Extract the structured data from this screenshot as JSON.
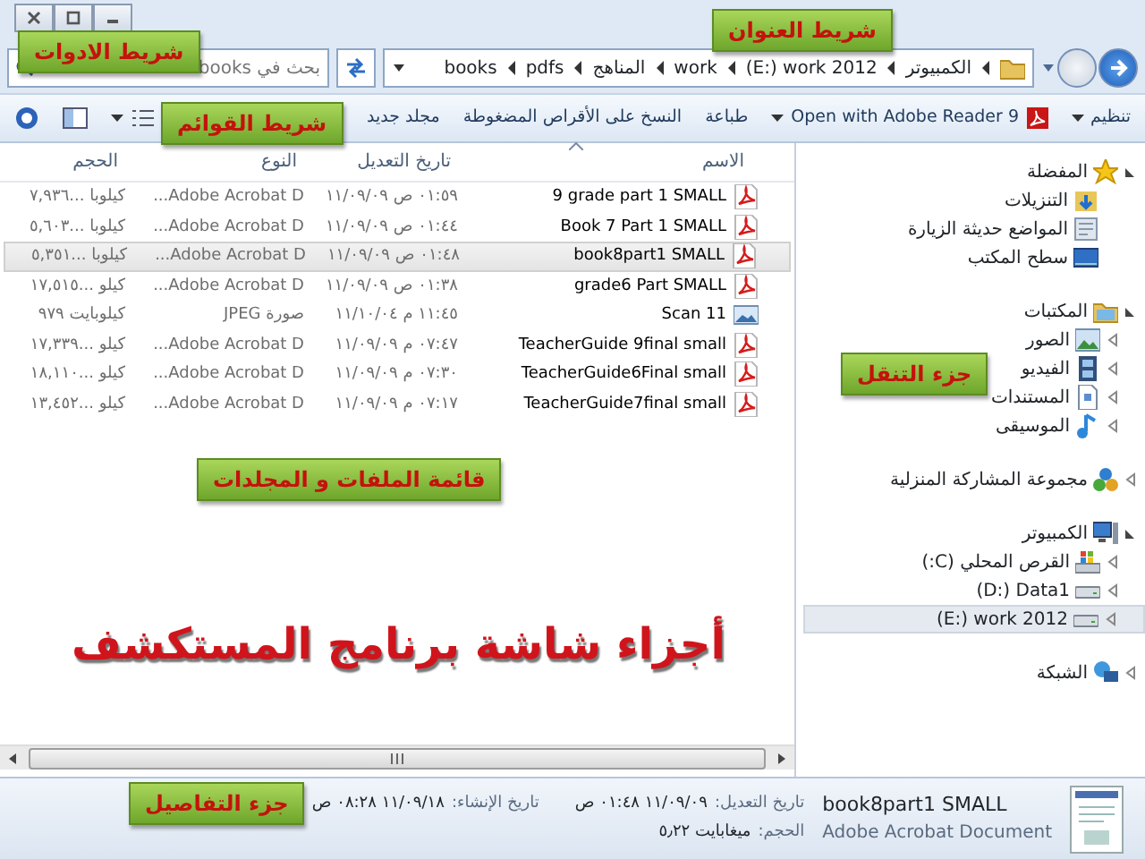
{
  "address_bar": {
    "crumbs": [
      "الكمبيوتر",
      "(E:) work 2012",
      "work",
      "المناهج",
      "pdfs",
      "books"
    ]
  },
  "search": {
    "placeholder": "بحث في books"
  },
  "toolbar": {
    "items": [
      {
        "label": "تنظيم",
        "kind": "menu"
      },
      {
        "label": "Open with Adobe Reader 9",
        "kind": "pdf-menu"
      },
      {
        "label": "طباعة",
        "kind": "plain"
      },
      {
        "label": "النسخ على الأقراص المضغوطة",
        "kind": "plain"
      },
      {
        "label": "مجلد جديد",
        "kind": "plain"
      }
    ]
  },
  "file_list": {
    "columns": [
      "الاسم",
      "تاريخ التعديل",
      "النوع",
      "الحجم"
    ],
    "rows": [
      {
        "name": "9 grade part 1 SMALL",
        "kind": "pdf",
        "date": "٠١:٥٩ ص ١١/٠٩/٠٩",
        "type": "Adobe Acrobat D...",
        "size": "كيلوبا ...٧,٩٣٦",
        "selected": false
      },
      {
        "name": "Book 7 Part 1 SMALL",
        "kind": "pdf",
        "date": "٠١:٤٤ ص ١١/٠٩/٠٩",
        "type": "Adobe Acrobat D...",
        "size": "كيلوبا ...٥,٦٠٣",
        "selected": false
      },
      {
        "name": "book8part1 SMALL",
        "kind": "pdf",
        "date": "٠١:٤٨ ص ١١/٠٩/٠٩",
        "type": "Adobe Acrobat D...",
        "size": "كيلوبا ...٥,٣٥١",
        "selected": true
      },
      {
        "name": "grade6 Part SMALL",
        "kind": "pdf",
        "date": "٠١:٣٨ ص ١١/٠٩/٠٩",
        "type": "Adobe Acrobat D...",
        "size": "كيلو ...١٧,٥١٥",
        "selected": false
      },
      {
        "name": "Scan 11",
        "kind": "image",
        "date": "١١:٤٥ م ١١/١٠/٠٤",
        "type": "صورة JPEG",
        "size": "كيلوبايت ٩٧٩",
        "selected": false
      },
      {
        "name": "TeacherGuide 9final small",
        "kind": "pdf",
        "date": "٠٧:٤٧ م ١١/٠٩/٠٩",
        "type": "Adobe Acrobat D...",
        "size": "كيلو ...١٧,٣٣٩",
        "selected": false
      },
      {
        "name": "TeacherGuide6Final small",
        "kind": "pdf",
        "date": "٠٧:٣٠ م ١١/٠٩/٠٩",
        "type": "Adobe Acrobat D...",
        "size": "كيلو ...١٨,١١٠",
        "selected": false
      },
      {
        "name": "TeacherGuide7final small",
        "kind": "pdf",
        "date": "٠٧:١٧ م ١١/٠٩/٠٩",
        "type": "Adobe Acrobat D...",
        "size": "كيلو ...١٣,٤٥٢",
        "selected": false
      }
    ]
  },
  "navigation_pane": {
    "groups": [
      {
        "label": "المفضلة",
        "kind": "favorites",
        "expanded": true,
        "children": [
          {
            "label": "التنزيلات",
            "kind": "downloads",
            "selected": false
          },
          {
            "label": "المواضع حديثة الزيارة",
            "kind": "recent",
            "selected": false
          },
          {
            "label": "سطح المكتب",
            "kind": "desktop",
            "selected": false
          }
        ]
      },
      {
        "label": "المكتبات",
        "kind": "libraries",
        "expanded": true,
        "children": [
          {
            "label": "الصور",
            "kind": "pictures",
            "expanded": false,
            "selected": false
          },
          {
            "label": "الفيديو",
            "kind": "videos",
            "expanded": false,
            "selected": false
          },
          {
            "label": "المستندات",
            "kind": "documents",
            "expanded": false,
            "selected": false
          },
          {
            "label": "الموسيقى",
            "kind": "music",
            "expanded": false,
            "selected": false
          }
        ]
      },
      {
        "label": "مجموعة المشاركة المنزلية",
        "kind": "homegroup",
        "expanded": false
      },
      {
        "label": "الكمبيوتر",
        "kind": "computer",
        "expanded": true,
        "children": [
          {
            "label": "القرص المحلي (C:)",
            "kind": "system-drive",
            "expanded": false,
            "selected": false
          },
          {
            "label": "(D:) Data1",
            "kind": "drive",
            "expanded": false,
            "selected": false
          },
          {
            "label": "(E:) work 2012",
            "kind": "drive",
            "expanded": false,
            "selected": true
          }
        ]
      },
      {
        "label": "الشبكة",
        "kind": "network",
        "expanded": false
      }
    ]
  },
  "details_pane": {
    "name": "book8part1 SMALL",
    "type": "Adobe Acrobat Document",
    "fields": [
      {
        "label": "تاريخ التعديل:",
        "value": "١١/٠٩/٠٩ ٠١:٤٨ ص"
      },
      {
        "label": "الحجم:",
        "value": "ميغابايت ٥٫٢٢"
      },
      {
        "label": "تاريخ الإنشاء:",
        "value": "١١/٠٩/١٨ ٠٨:٢٨ ص"
      }
    ]
  },
  "callouts": {
    "address_bar": "شريط العنوان",
    "toolbar": "شريط الادوات",
    "menu_bar": "شريط القوائم",
    "navigation_pane": "جزء التنقل",
    "file_list": "قائمة الملفات و المجلدات",
    "details_pane": "جزء التفاصيل"
  },
  "heading": "أجزاء شاشة برنامج المستكشف"
}
